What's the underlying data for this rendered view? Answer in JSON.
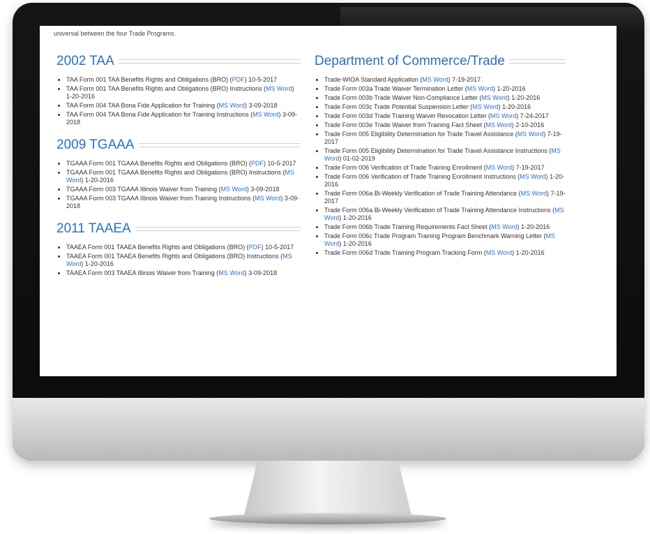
{
  "intro_text": "universal between the four Trade Programs.",
  "sections_left": [
    {
      "title": "2002 TAA",
      "items": [
        {
          "pre": "TAA Form 001 TAA Benefits Rights and Obligations (BRO) (",
          "link": "PDF",
          "post": ") 10-5-2017"
        },
        {
          "pre": "TAA Form 001 TAA Benefits Rights and Obligations (BRO) Instructions (",
          "link": "MS Word",
          "post": ") 1-20-2016"
        },
        {
          "pre": "TAA Form 004 TAA Bona Fide Application for Training (",
          "link": "MS Word",
          "post": ") 3-09-2018"
        },
        {
          "pre": "TAA Form 004 TAA Bona Fide Application for Training Instructions (",
          "link": "MS Word",
          "post": ") 3-09-2018"
        }
      ]
    },
    {
      "title": "2009 TGAAA",
      "items": [
        {
          "pre": "TGAAA Form 001 TGAAA Benefits Rights and Obligations (BRO) (",
          "link": "PDF",
          "post": ") 10-5-2017"
        },
        {
          "pre": "TGAAA Form 001 TGAAA Benefits Rights and Obligations (BRO) Instructions (",
          "link": "MS Word",
          "post": ") 1-20-2016"
        },
        {
          "pre": "TGAAA Form 003 TGAAA Illinois Waiver from Training (",
          "link": "MS Word",
          "post": ") 3-09-2018"
        },
        {
          "pre": "TGAAA Form 003 TGAAA Illinois Waiver from Training Instructions (",
          "link": "MS Word",
          "post": ") 3-09-2018"
        }
      ]
    },
    {
      "title": "2011 TAAEA",
      "items": [
        {
          "pre": "TAAEA Form 001 TAAEA Benefits Rights and Obligations (BRO) (",
          "link": "PDF",
          "post": ") 10-5-2017"
        },
        {
          "pre": "TAAEA Form 001 TAAEA Benefits Rights and Obligations (BRO) Instructions (",
          "link": "MS Word",
          "post": ") 1-20-2016"
        },
        {
          "pre": "TAAEA Form 003 TAAEA Illinois Waiver from Training (",
          "link": "MS Word",
          "post": ") 3-09-2018"
        }
      ]
    }
  ],
  "sections_right": [
    {
      "title": "Department of Commerce/Trade",
      "items": [
        {
          "pre": "Trade-WIOA Standard Application (",
          "link": "MS Word",
          "post": ") 7-19-2017"
        },
        {
          "pre": "Trade Form 003a Trade Waiver Termination Letter (",
          "link": "MS Word",
          "post": ") 1-20-2016"
        },
        {
          "pre": "Trade Form 003b Trade Waiver Non-Compliance Letter (",
          "link": "MS Word",
          "post": ") 1-20-2016"
        },
        {
          "pre": "Trade Form 003c Trade Potential Suspension Letter (",
          "link": "MS Word",
          "post": ") 1-20-2016"
        },
        {
          "pre": "Trade Form 003d Trade Training Waiver Revocation Letter (",
          "link": "MS Word",
          "post": ") 7-24-2017"
        },
        {
          "pre": "Trade Form 003e Trade Waiver from Training Fact Sheet (",
          "link": "MS Word",
          "post": ") 2-10-2016"
        },
        {
          "pre": "Trade Form 005 Eligibility Determination for Trade Travel Assistance (",
          "link": "MS Word",
          "post": ") 7-19-2017"
        },
        {
          "pre": "Trade Form 005 Eligibility Determination for Trade Travel Assistance Instructions (",
          "link": "MS Word",
          "post": ") 01-02-2019"
        },
        {
          "pre": "Trade Form 006 Verification of Trade Training Enrollment (",
          "link": "MS Word",
          "post": ") 7-19-2017"
        },
        {
          "pre": "Trade Form 006 Verification of Trade Training Enrollment Instructions (",
          "link": "MS Word",
          "post": ") 1-20-2016"
        },
        {
          "pre": "Trade Form 006a Bi-Weekly Verification of Trade Training Attendance (",
          "link": "MS Word",
          "post": ") 7-19-2017"
        },
        {
          "pre": "Trade Form 006a Bi-Weekly Verification of Trade Training Attendance Instructions (",
          "link": "MS Word",
          "post": ") 1-20-2016"
        },
        {
          "pre": "Trade Form 006b Trade Training Requirements Fact Sheet (",
          "link": "MS Word",
          "post": ") 1-20-2016"
        },
        {
          "pre": "Trade Form 006c Trade Program Training Program Benchmark Warning Letter (",
          "link": "MS Word",
          "post": ") 1-20-2016"
        },
        {
          "pre": "Trade Form 006d Trade Training Program Tracking Form (",
          "link": "MS Word",
          "post": ") 1-20-2016"
        }
      ]
    }
  ]
}
